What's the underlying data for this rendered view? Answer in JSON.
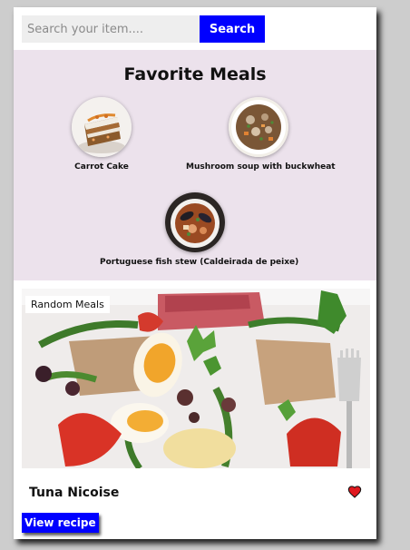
{
  "search": {
    "placeholder": "Search your item....",
    "value": "",
    "button_label": "Search"
  },
  "favorites": {
    "title": "Favorite Meals",
    "items": [
      {
        "label": "Carrot Cake",
        "image": "carrot-cake-photo"
      },
      {
        "label": "Mushroom soup with buckwheat",
        "image": "mushroom-soup-photo"
      },
      {
        "label": "Portuguese fish stew (Caldeirada de peixe)",
        "image": "fish-stew-photo"
      }
    ]
  },
  "random": {
    "tag": "Random Meals",
    "meal_name": "Tuna Nicoise",
    "image": "tuna-nicoise-salad-photo",
    "favorite_icon": "heart-icon",
    "view_label": "View recipe"
  },
  "colors": {
    "accent": "#0000ff",
    "favorites_bg": "#ece2ec",
    "heart": "#e0191f",
    "page_bg": "#cdcdcd"
  }
}
